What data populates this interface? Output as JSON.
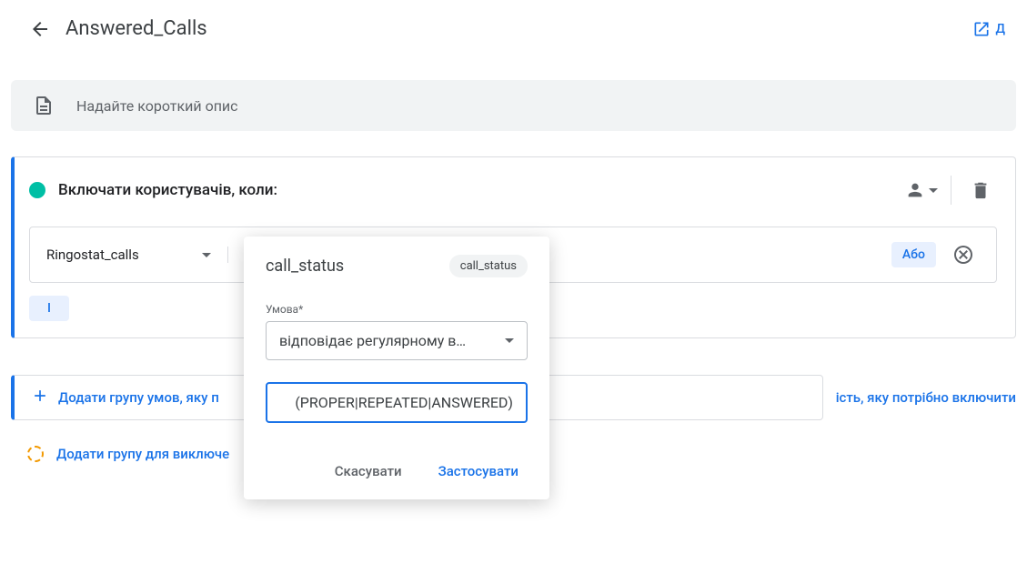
{
  "header": {
    "title": "Answered_Calls",
    "open_label": "Д"
  },
  "desc_placeholder": "Надайте короткий опис",
  "include": {
    "title": "Включати користувачів, коли:",
    "event": "Ringostat_calls",
    "or_label": "Або",
    "i_label": "І"
  },
  "links": {
    "add_group": "Додати групу умов, яку п",
    "add_sequence": "ість, яку потрібно включити",
    "add_exclude": "Додати групу для виключе"
  },
  "popover": {
    "title": "call_status",
    "chip": "call_status",
    "cond_label": "Умова*",
    "cond_value": "відповідає регулярному в…",
    "value": "(PROPER|REPEATED|ANSWERED)",
    "cancel": "Скасувати",
    "apply": "Застосувати"
  }
}
